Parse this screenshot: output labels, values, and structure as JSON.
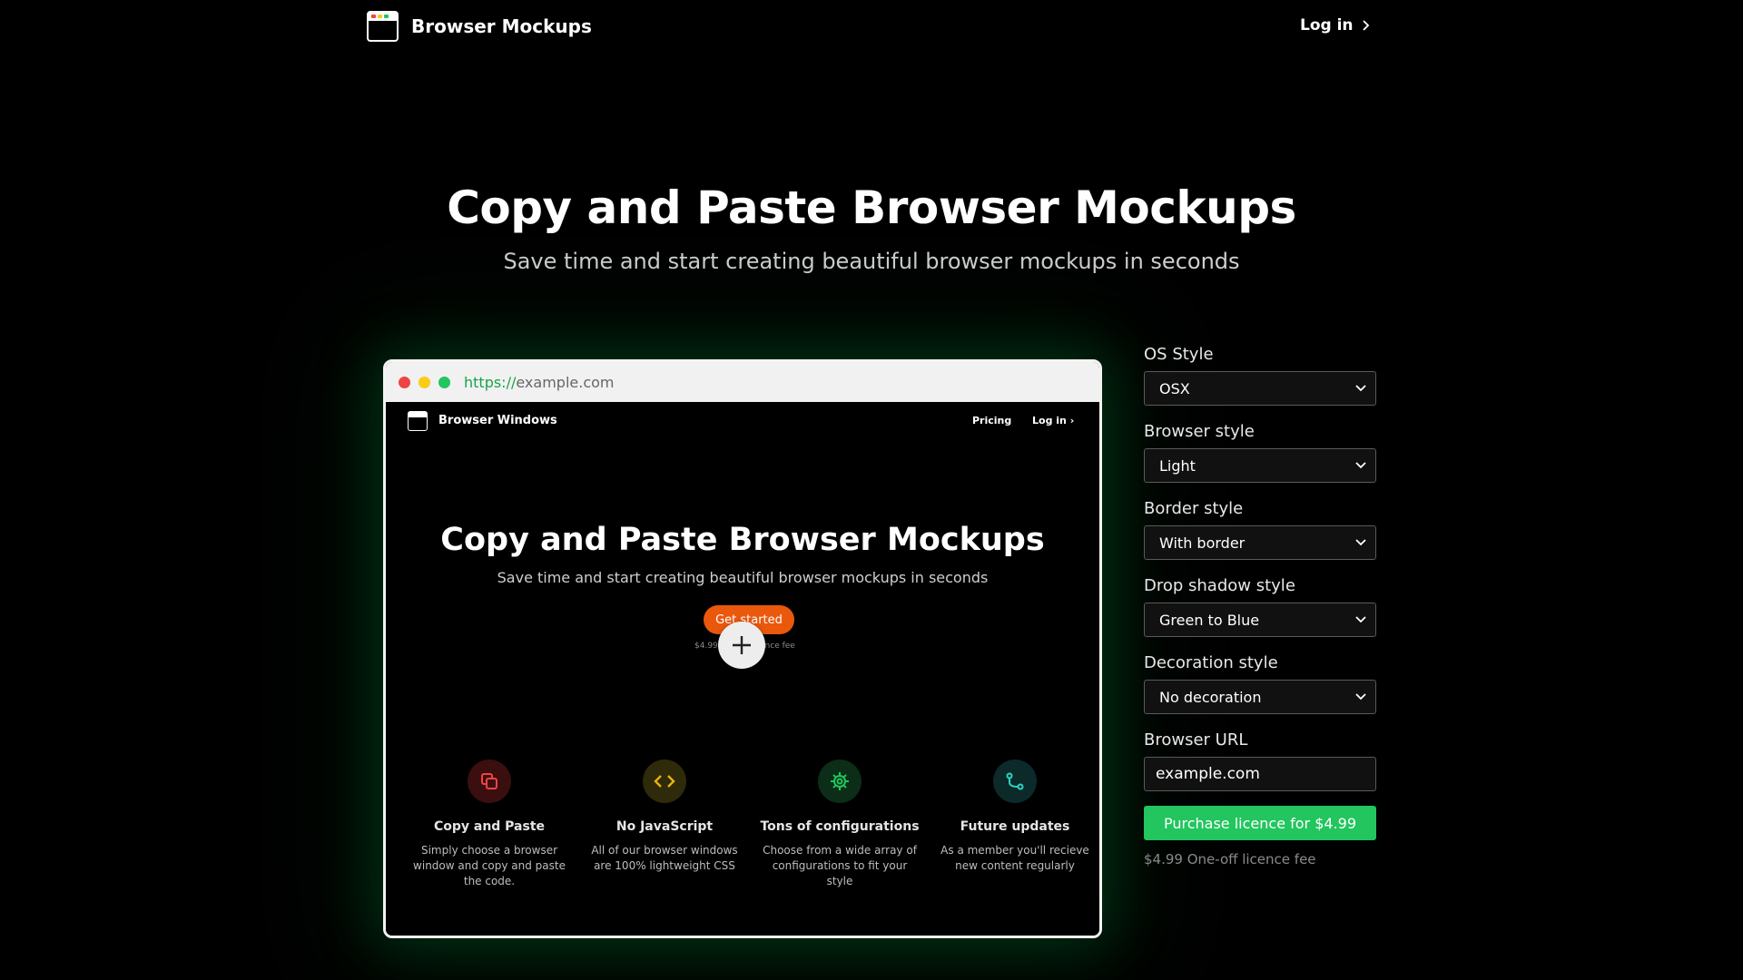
{
  "brand": {
    "name": "Browser Mockups",
    "logo_icon": "browser-window-icon"
  },
  "nav": {
    "login_label": "Log in",
    "login_icon": "chevron-right-icon"
  },
  "hero": {
    "title": "Copy and Paste Browser Mockups",
    "subtitle": "Save time and start creating beautiful browser mockups in seconds"
  },
  "mockup": {
    "dots": [
      "#ef4444",
      "#facc15",
      "#22c55e"
    ],
    "url_protocol": "https://",
    "url_domain": "example.com",
    "inner": {
      "brand": "Browser Windows",
      "nav_pricing": "Pricing",
      "nav_login": "Log in",
      "title": "Copy and Paste Browser Mockups",
      "subtitle": "Save time and start creating beautiful browser mockups in seconds",
      "cta": "Get started",
      "fee_left": "$4.99",
      "fee_right": "ence fee",
      "plus_icon": "plus-icon",
      "features": [
        {
          "title": "Copy and Paste",
          "desc": "Simply choose a browser window and copy and paste the code.",
          "icon": "copy-icon",
          "color": "#ef4444",
          "bg": "#3b0f0f"
        },
        {
          "title": "No JavaScript",
          "desc": "All of our browser windows are 100% lightweight CSS",
          "icon": "code-icon",
          "color": "#eab308",
          "bg": "#2e2a0a"
        },
        {
          "title": "Tons of configurations",
          "desc": "Choose from a wide array of configurations to fit your style",
          "icon": "gear-icon",
          "color": "#22c55e",
          "bg": "#0c2d17"
        },
        {
          "title": "Future updates",
          "desc": "As a member you'll recieve new content regularly",
          "icon": "git-branch-icon",
          "color": "#2dd4bf",
          "bg": "#0c2a2a"
        }
      ]
    }
  },
  "panel": {
    "os_style": {
      "label": "OS Style",
      "value": "OSX"
    },
    "browser_style": {
      "label": "Browser style",
      "value": "Light"
    },
    "border_style": {
      "label": "Border style",
      "value": "With border"
    },
    "shadow_style": {
      "label": "Drop shadow style",
      "value": "Green to Blue"
    },
    "decoration_style": {
      "label": "Decoration style",
      "value": "No decoration"
    },
    "browser_url": {
      "label": "Browser URL",
      "value": "example.com"
    },
    "purchase_label": "Purchase licence for $4.99",
    "purchase_note": "$4.99 One-off licence fee"
  },
  "colors": {
    "accent": "#22c55e",
    "cta_orange": "#ea580c",
    "background": "#000000"
  }
}
